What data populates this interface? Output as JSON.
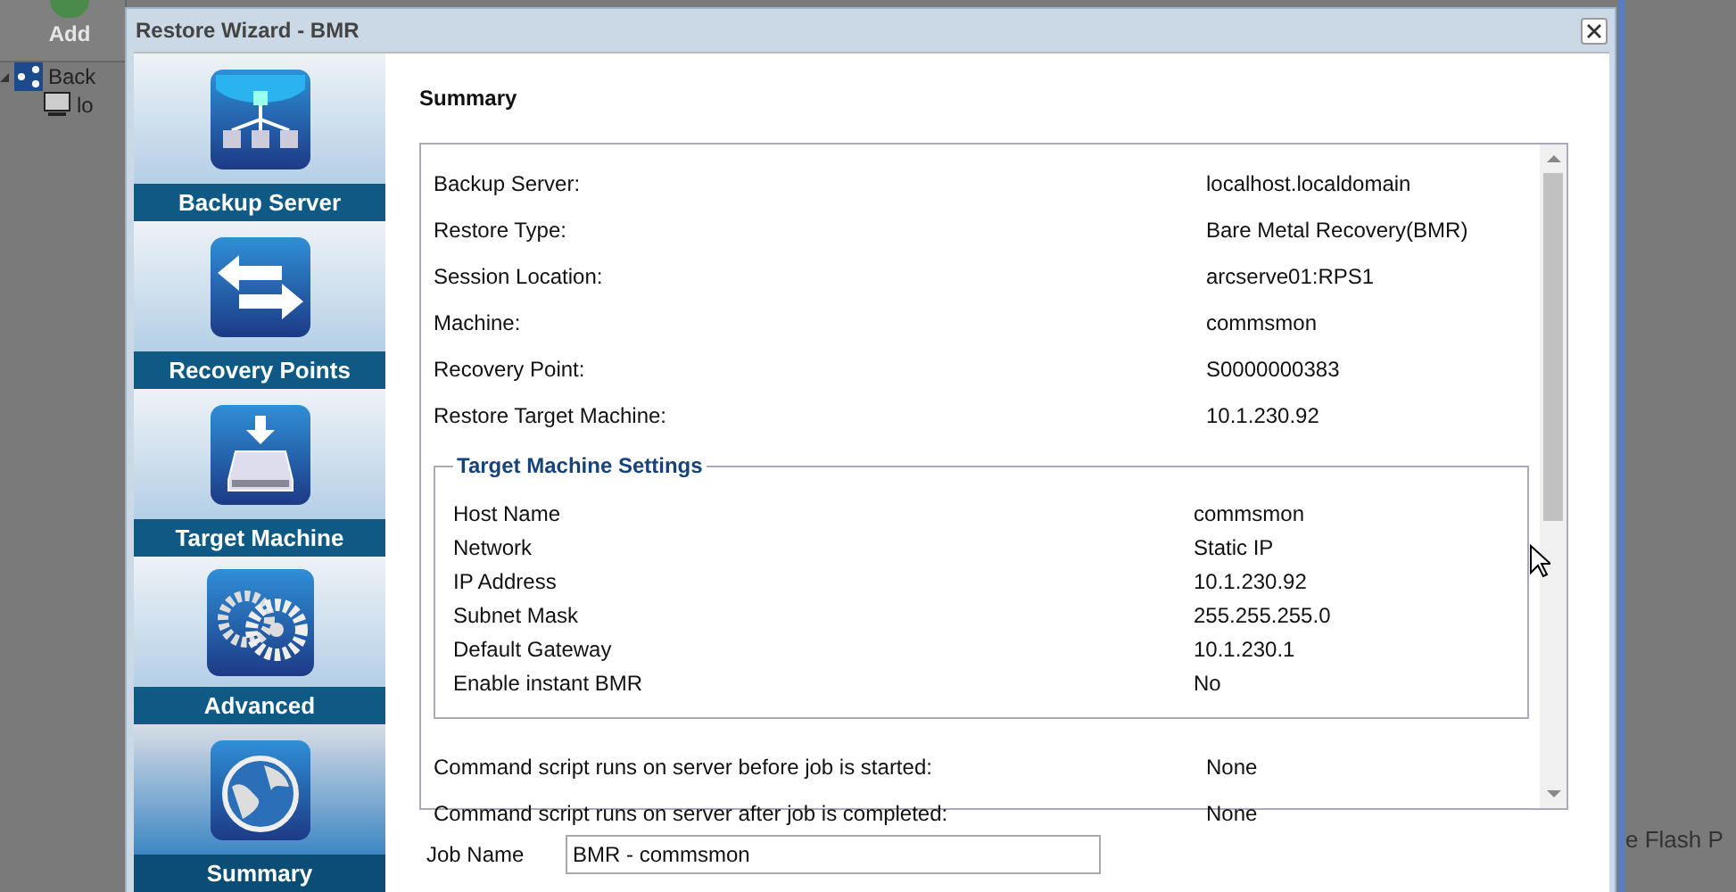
{
  "background": {
    "toolbar_button": "Add",
    "tree": [
      {
        "label": "Back",
        "expanded": true,
        "children": [
          {
            "label": "lo"
          }
        ]
      }
    ],
    "side_text": "e Flash P"
  },
  "dialog": {
    "title": "Restore Wizard - BMR",
    "steps": [
      {
        "label": "Backup Server",
        "selected": false
      },
      {
        "label": "Recovery Points",
        "selected": false
      },
      {
        "label": "Target Machine",
        "selected": false
      },
      {
        "label": "Advanced",
        "selected": false
      },
      {
        "label": "Summary",
        "selected": true
      }
    ],
    "heading": "Summary",
    "summary": [
      {
        "label": "Backup Server:",
        "value": "localhost.localdomain"
      },
      {
        "label": "Restore Type:",
        "value": "Bare Metal Recovery(BMR)"
      },
      {
        "label": "Session Location:",
        "value": "arcserve01:RPS1"
      },
      {
        "label": "Machine:",
        "value": "commsmon"
      },
      {
        "label": "Recovery Point:",
        "value": "S0000000383"
      },
      {
        "label": "Restore Target Machine:",
        "value": "10.1.230.92"
      }
    ],
    "target_settings": {
      "title": "Target Machine Settings",
      "rows": [
        {
          "label": "Host Name",
          "value": "commsmon"
        },
        {
          "label": "Network",
          "value": "Static IP"
        },
        {
          "label": "IP Address",
          "value": "10.1.230.92"
        },
        {
          "label": "Subnet Mask",
          "value": "255.255.255.0"
        },
        {
          "label": "Default Gateway",
          "value": "10.1.230.1"
        },
        {
          "label": "Enable instant BMR",
          "value": "No"
        }
      ]
    },
    "scripts": [
      {
        "label": "Command script runs on server before job is started:",
        "value": "None"
      },
      {
        "label": "Command script runs on server after job is completed:",
        "value": "None"
      }
    ],
    "job_name": {
      "label": "Job Name",
      "value": "BMR - commsmon"
    }
  }
}
